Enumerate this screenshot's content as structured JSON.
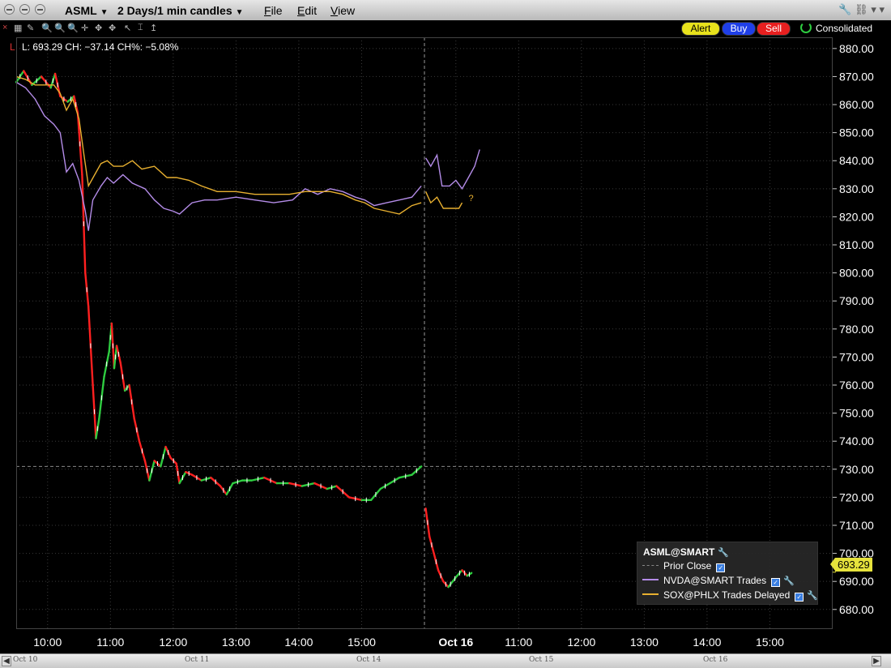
{
  "title_bar": {
    "symbol": "ASML",
    "timeframe": "2 Days/1 min candles",
    "menus": [
      "File",
      "Edit",
      "View"
    ]
  },
  "toolbar": {
    "close_icon": "close-icon",
    "alert_label": "Alert",
    "buy_label": "Buy",
    "sell_label": "Sell",
    "consolidated_label": "Consolidated",
    "colors": {
      "alert": "#e8e21c",
      "buy": "#1f3fe8",
      "sell": "#e81f1f"
    }
  },
  "status": {
    "text": "L: 693.29 CH: −37.14 CH%: −5.08%"
  },
  "price_tag": "693.29",
  "legend": {
    "title": "ASML@SMART",
    "items": [
      {
        "label": "Prior Close",
        "color": "#888888",
        "style": "dashed"
      },
      {
        "label": "NVDA@SMART Trades",
        "color": "#b48ce8",
        "style": "solid"
      },
      {
        "label": "SOX@PHLX Trades Delayed",
        "color": "#e8b030",
        "style": "solid"
      }
    ]
  },
  "scrollbar": {
    "labels": [
      "Oct 10",
      "Oct 11",
      "Oct 14",
      "Oct 15",
      "Oct 16"
    ]
  },
  "chart_data": {
    "type": "line",
    "y_ticks": [
      "880.00",
      "870.00",
      "860.00",
      "850.00",
      "840.00",
      "830.00",
      "820.00",
      "810.00",
      "800.00",
      "790.00",
      "780.00",
      "770.00",
      "760.00",
      "750.00",
      "740.00",
      "730.00",
      "720.00",
      "710.00",
      "700.00",
      "690.00",
      "680.00"
    ],
    "ylim": [
      673,
      884
    ],
    "x_ticks": [
      "10:00",
      "11:00",
      "12:00",
      "13:00",
      "14:00",
      "15:00",
      "Oct 16",
      "11:00",
      "12:00",
      "13:00",
      "14:00",
      "15:00"
    ],
    "x_tick_values": [
      10.0,
      11.0,
      12.0,
      13.0,
      14.0,
      15.0,
      16.5,
      17.5,
      18.5,
      19.5,
      20.5,
      21.5
    ],
    "x_range": [
      9.5,
      22.5
    ],
    "day_break_x": 16.0,
    "prior_close": 731,
    "current_price": 693.29,
    "grid": true,
    "series": [
      {
        "name": "ASML",
        "kind": "candles",
        "color_up": "#2ecc40",
        "color_down": "#ff2020",
        "points": [
          [
            9.5,
            868
          ],
          [
            9.62,
            872
          ],
          [
            9.75,
            867
          ],
          [
            9.9,
            870
          ],
          [
            10.05,
            866
          ],
          [
            10.12,
            871
          ],
          [
            10.2,
            863
          ],
          [
            10.32,
            861
          ],
          [
            10.42,
            863
          ],
          [
            10.48,
            857
          ],
          [
            10.55,
            835
          ],
          [
            10.6,
            800
          ],
          [
            10.65,
            788
          ],
          [
            10.72,
            760
          ],
          [
            10.77,
            741
          ],
          [
            10.82,
            748
          ],
          [
            10.9,
            763
          ],
          [
            10.98,
            772
          ],
          [
            11.02,
            782
          ],
          [
            11.06,
            766
          ],
          [
            11.1,
            774
          ],
          [
            11.16,
            768
          ],
          [
            11.23,
            758
          ],
          [
            11.3,
            760
          ],
          [
            11.38,
            748
          ],
          [
            11.46,
            740
          ],
          [
            11.55,
            733
          ],
          [
            11.62,
            726
          ],
          [
            11.7,
            733
          ],
          [
            11.8,
            731
          ],
          [
            11.88,
            738
          ],
          [
            11.96,
            734
          ],
          [
            12.05,
            732
          ],
          [
            12.1,
            725
          ],
          [
            12.2,
            729
          ],
          [
            12.3,
            728
          ],
          [
            12.45,
            726
          ],
          [
            12.6,
            727
          ],
          [
            12.75,
            724
          ],
          [
            12.85,
            721
          ],
          [
            12.95,
            725
          ],
          [
            13.1,
            726
          ],
          [
            13.25,
            726
          ],
          [
            13.45,
            727
          ],
          [
            13.65,
            725
          ],
          [
            13.85,
            725
          ],
          [
            14.05,
            724
          ],
          [
            14.25,
            725
          ],
          [
            14.45,
            723
          ],
          [
            14.6,
            724
          ],
          [
            14.8,
            720
          ],
          [
            15.0,
            719
          ],
          [
            15.15,
            719
          ],
          [
            15.3,
            723
          ],
          [
            15.45,
            725
          ],
          [
            15.6,
            727
          ],
          [
            15.8,
            728
          ],
          [
            15.95,
            731
          ],
          [
            16.02,
            716
          ],
          [
            16.08,
            706
          ],
          [
            16.15,
            700
          ],
          [
            16.22,
            694
          ],
          [
            16.3,
            690
          ],
          [
            16.38,
            688
          ],
          [
            16.45,
            690
          ],
          [
            16.52,
            692
          ],
          [
            16.6,
            694
          ],
          [
            16.68,
            692
          ],
          [
            16.75,
            693
          ]
        ]
      },
      {
        "name": "NVDA@SMART Trades",
        "kind": "line",
        "color": "#b48ce8",
        "points": [
          [
            9.5,
            868
          ],
          [
            9.65,
            866
          ],
          [
            9.8,
            862
          ],
          [
            9.95,
            856
          ],
          [
            10.1,
            853
          ],
          [
            10.2,
            850
          ],
          [
            10.3,
            836
          ],
          [
            10.4,
            839
          ],
          [
            10.5,
            833
          ],
          [
            10.6,
            822
          ],
          [
            10.65,
            815
          ],
          [
            10.72,
            826
          ],
          [
            10.85,
            831
          ],
          [
            10.95,
            834
          ],
          [
            11.05,
            832
          ],
          [
            11.2,
            835
          ],
          [
            11.35,
            832
          ],
          [
            11.55,
            830
          ],
          [
            11.7,
            826
          ],
          [
            11.85,
            823
          ],
          [
            12.0,
            822
          ],
          [
            12.1,
            821
          ],
          [
            12.3,
            825
          ],
          [
            12.5,
            826
          ],
          [
            12.7,
            826
          ],
          [
            13.0,
            827
          ],
          [
            13.3,
            826
          ],
          [
            13.6,
            825
          ],
          [
            13.9,
            826
          ],
          [
            14.1,
            830
          ],
          [
            14.3,
            828
          ],
          [
            14.5,
            830
          ],
          [
            14.7,
            829
          ],
          [
            14.9,
            827
          ],
          [
            15.05,
            826
          ],
          [
            15.2,
            824
          ],
          [
            15.4,
            825
          ],
          [
            15.6,
            826
          ],
          [
            15.8,
            827
          ],
          [
            15.95,
            831
          ],
          [
            16.02,
            841
          ],
          [
            16.1,
            838
          ],
          [
            16.2,
            842
          ],
          [
            16.28,
            831
          ],
          [
            16.4,
            831
          ],
          [
            16.5,
            833
          ],
          [
            16.6,
            830
          ],
          [
            16.7,
            834
          ],
          [
            16.8,
            838
          ],
          [
            16.88,
            844
          ]
        ]
      },
      {
        "name": "SOX@PHLX Trades Delayed",
        "kind": "line",
        "color": "#e8b030",
        "points": [
          [
            9.5,
            870
          ],
          [
            9.65,
            869
          ],
          [
            9.8,
            867
          ],
          [
            9.95,
            867
          ],
          [
            10.1,
            867
          ],
          [
            10.2,
            864
          ],
          [
            10.3,
            858
          ],
          [
            10.4,
            862
          ],
          [
            10.5,
            855
          ],
          [
            10.58,
            842
          ],
          [
            10.65,
            831
          ],
          [
            10.75,
            835
          ],
          [
            10.85,
            839
          ],
          [
            10.95,
            840
          ],
          [
            11.05,
            838
          ],
          [
            11.2,
            838
          ],
          [
            11.35,
            840
          ],
          [
            11.5,
            837
          ],
          [
            11.7,
            838
          ],
          [
            11.9,
            834
          ],
          [
            12.05,
            834
          ],
          [
            12.25,
            833
          ],
          [
            12.45,
            831
          ],
          [
            12.7,
            829
          ],
          [
            13.0,
            829
          ],
          [
            13.3,
            828
          ],
          [
            13.6,
            828
          ],
          [
            13.85,
            828
          ],
          [
            14.1,
            829
          ],
          [
            14.3,
            829
          ],
          [
            14.5,
            829
          ],
          [
            14.7,
            828
          ],
          [
            14.9,
            826
          ],
          [
            15.05,
            825
          ],
          [
            15.2,
            823
          ],
          [
            15.4,
            822
          ],
          [
            15.6,
            821
          ],
          [
            15.8,
            824
          ],
          [
            15.95,
            825
          ],
          [
            16.02,
            829
          ],
          [
            16.1,
            825
          ],
          [
            16.2,
            827
          ],
          [
            16.3,
            823
          ],
          [
            16.45,
            823
          ],
          [
            16.55,
            823
          ],
          [
            16.6,
            825
          ]
        ]
      }
    ]
  }
}
